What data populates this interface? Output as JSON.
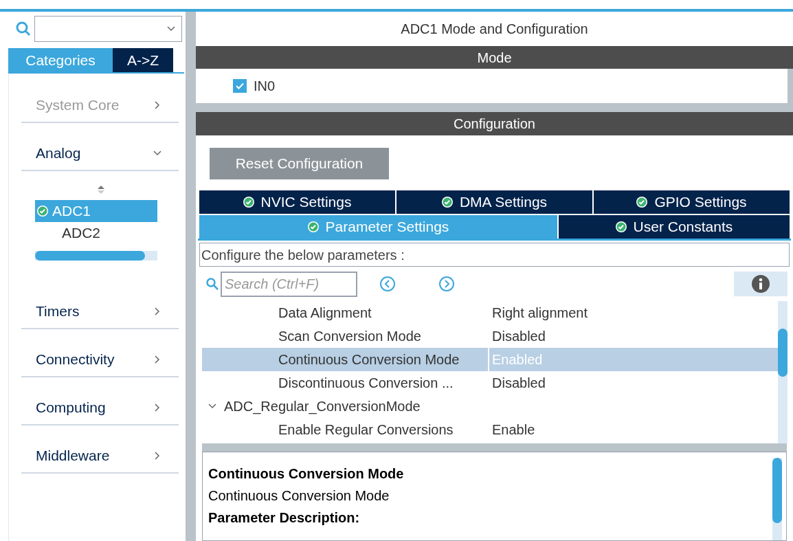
{
  "sidebar": {
    "tabs": [
      {
        "label": "Categories",
        "selected": true
      },
      {
        "label": "A->Z",
        "selected": false
      }
    ],
    "categories": [
      {
        "label": "System Core",
        "disabled": true,
        "expanded": false
      },
      {
        "label": "Analog",
        "disabled": false,
        "expanded": true,
        "children": [
          {
            "label": "ADC1",
            "selected": true,
            "configured": true
          },
          {
            "label": "ADC2",
            "selected": false,
            "configured": false
          }
        ]
      },
      {
        "label": "Timers",
        "disabled": false,
        "expanded": false
      },
      {
        "label": "Connectivity",
        "disabled": false,
        "expanded": false
      },
      {
        "label": "Computing",
        "disabled": false,
        "expanded": false
      },
      {
        "label": "Middleware",
        "disabled": false,
        "expanded": false
      }
    ]
  },
  "panel": {
    "title": "ADC1 Mode and Configuration",
    "mode": {
      "header": "Mode",
      "channels": [
        {
          "label": "IN0",
          "checked": true
        }
      ]
    },
    "configuration": {
      "header": "Configuration",
      "reset_button": "Reset Configuration",
      "tab_rows": [
        [
          {
            "label": "NVIC Settings",
            "selected": false
          },
          {
            "label": "DMA Settings",
            "selected": false
          },
          {
            "label": "GPIO Settings",
            "selected": false
          }
        ],
        [
          {
            "label": "Parameter Settings",
            "selected": true
          },
          {
            "label": "User Constants",
            "selected": false
          }
        ]
      ],
      "caption": "Configure the below parameters :",
      "search": {
        "placeholder": "Search (Ctrl+F)"
      },
      "parameters": [
        {
          "kind": "param",
          "name": "Data Alignment",
          "value": "Right alignment",
          "selected": false
        },
        {
          "kind": "param",
          "name": "Scan Conversion Mode",
          "value": "Disabled",
          "selected": false
        },
        {
          "kind": "param",
          "name": "Continuous Conversion Mode",
          "value": "Enabled",
          "selected": true
        },
        {
          "kind": "param",
          "name": "Discontinuous Conversion ...",
          "value": "Disabled",
          "selected": false
        },
        {
          "kind": "group",
          "name": "ADC_Regular_ConversionMode",
          "expanded": true,
          "children": [
            {
              "kind": "param",
              "name": "Enable Regular Conversions",
              "value": "Enable",
              "selected": false
            }
          ]
        }
      ],
      "description": {
        "title": "Continuous Conversion Mode",
        "subtitle": "Continuous Conversion Mode",
        "heading": "Parameter Description:"
      }
    }
  }
}
